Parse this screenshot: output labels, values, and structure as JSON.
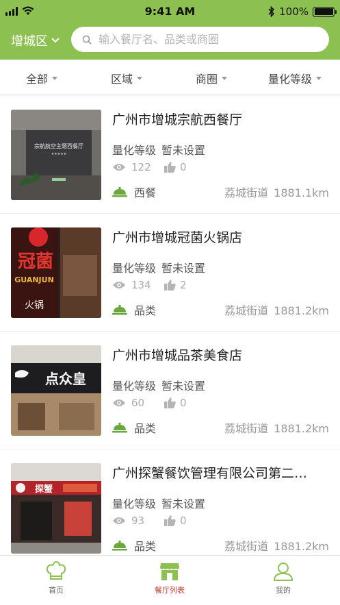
{
  "status_bar": {
    "time": "9:41 AM",
    "battery": "100%"
  },
  "header": {
    "district": "增城区",
    "search_placeholder": "输入餐厅名、品类或商圈"
  },
  "filters": [
    {
      "label": "全部"
    },
    {
      "label": "区域"
    },
    {
      "label": "商圈"
    },
    {
      "label": "量化等级"
    }
  ],
  "restaurants": [
    {
      "name": "广州市增城宗航西餐厅",
      "grade_label": "量化等级",
      "grade_value": "暂未设置",
      "views": "122",
      "likes": "0",
      "category": "西餐",
      "street": "荔城街道",
      "distance": "1881.1km",
      "thumb_sign": "宗航航空主题西餐厅"
    },
    {
      "name": "广州市增城冠菌火锅店",
      "grade_label": "量化等级",
      "grade_value": "暂未设置",
      "views": "134",
      "likes": "2",
      "category": "品类",
      "street": "荔城街道",
      "distance": "1881.2km",
      "thumb_sign": "冠菌"
    },
    {
      "name": "广州市增城品茶美食店",
      "grade_label": "量化等级",
      "grade_value": "暂未设置",
      "views": "60",
      "likes": "0",
      "category": "品类",
      "street": "荔城街道",
      "distance": "1881.2km",
      "thumb_sign": "点众皇"
    },
    {
      "name": "广州探蟹餐饮管理有限公司第二…",
      "grade_label": "量化等级",
      "grade_value": "暂未设置",
      "views": "93",
      "likes": "0",
      "category": "品类",
      "street": "荔城街道",
      "distance": "1881.2km",
      "thumb_sign": "探蟹"
    }
  ],
  "tabbar": [
    {
      "label": "首页"
    },
    {
      "label": "餐厅列表"
    },
    {
      "label": "我的"
    }
  ],
  "colors": {
    "brand": "#8cc152",
    "active_tab": "#c0392b"
  }
}
